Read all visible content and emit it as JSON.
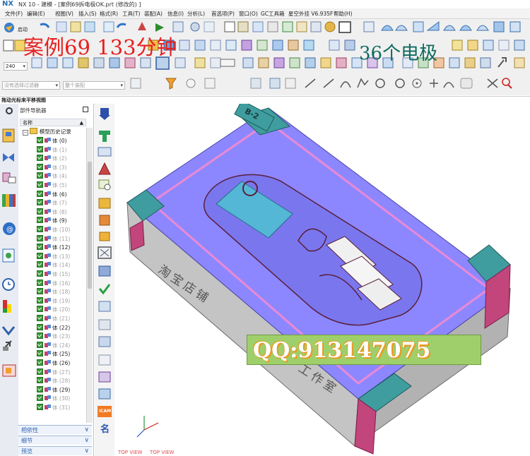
{
  "window": {
    "logo": "NX",
    "title": "NX 10 - 建模 - [案例69拆电极OK.prt  (修改的) ]"
  },
  "menu": [
    "文件(F)",
    "编辑(E)",
    "视图(V)",
    "插入(S)",
    "格式(R)",
    "工具(T)",
    "装配(A)",
    "信息(I)",
    "分析(L)",
    "首选项(P)",
    "窗口(O)",
    "GC工具箱",
    "星空外挂 V6.935F",
    "帮助(H)"
  ],
  "toolbar": {
    "start_label": "启动",
    "zoom_value": "240",
    "filter_placeholder": "没有选择过滤器",
    "assembly_placeholder": "整个装配"
  },
  "overlays": {
    "red_text": "案例69   133分钟",
    "teal_text": "36个电极",
    "qq_banner": "QQ:913147075"
  },
  "status_strip": "拖动光标来平移视图",
  "navigator": {
    "title": "部件导航器",
    "column": "名称",
    "root": "模型历史记录",
    "items": [
      {
        "label": "体 (0)",
        "active": true
      },
      {
        "label": "体 (1)",
        "active": false
      },
      {
        "label": "体 (2)",
        "active": false
      },
      {
        "label": "体 (3)",
        "active": false
      },
      {
        "label": "体 (4)",
        "active": false
      },
      {
        "label": "体 (5)",
        "active": false
      },
      {
        "label": "体 (6)",
        "active": true
      },
      {
        "label": "体 (7)",
        "active": false
      },
      {
        "label": "体 (8)",
        "active": false
      },
      {
        "label": "体 (9)",
        "active": true
      },
      {
        "label": "体 (10)",
        "active": false
      },
      {
        "label": "体 (11)",
        "active": false
      },
      {
        "label": "体 (12)",
        "active": true
      },
      {
        "label": "体 (13)",
        "active": false
      },
      {
        "label": "体 (14)",
        "active": false
      },
      {
        "label": "体 (15)",
        "active": false
      },
      {
        "label": "体 (16)",
        "active": false
      },
      {
        "label": "体 (18)",
        "active": false
      },
      {
        "label": "体 (19)",
        "active": false
      },
      {
        "label": "体 (20)",
        "active": false
      },
      {
        "label": "体 (21)",
        "active": false
      },
      {
        "label": "体 (22)",
        "active": true
      },
      {
        "label": "体 (23)",
        "active": false
      },
      {
        "label": "体 (24)",
        "active": false
      },
      {
        "label": "体 (25)",
        "active": true
      },
      {
        "label": "体 (26)",
        "active": true
      },
      {
        "label": "体 (27)",
        "active": false
      },
      {
        "label": "体 (28)",
        "active": false
      },
      {
        "label": "体 (29)",
        "active": true
      },
      {
        "label": "体 (30)",
        "active": false
      },
      {
        "label": "体 (31)",
        "active": false
      }
    ],
    "panels": [
      "相依性",
      "细节",
      "预览"
    ]
  },
  "vbar": {
    "icam_label": "iCAM",
    "name_label": "名"
  },
  "viewport": {
    "part_label": "B-2",
    "engraving_1": "淘宝店铺",
    "engraving_2": "工作室",
    "view_labels": [
      "TOP VIEW",
      "TOP VIEW"
    ]
  },
  "colors": {
    "mold_top": "#8d87ff",
    "mold_side": "#c4c4c4",
    "corner_teal": "#3f9d9f",
    "corner_magenta": "#c2457c",
    "electrode_cyan": "#55b7d6",
    "red_overlay": "#e81e1e",
    "teal_overlay": "#0f6b5f",
    "qq_green": "#9fcf6a"
  }
}
